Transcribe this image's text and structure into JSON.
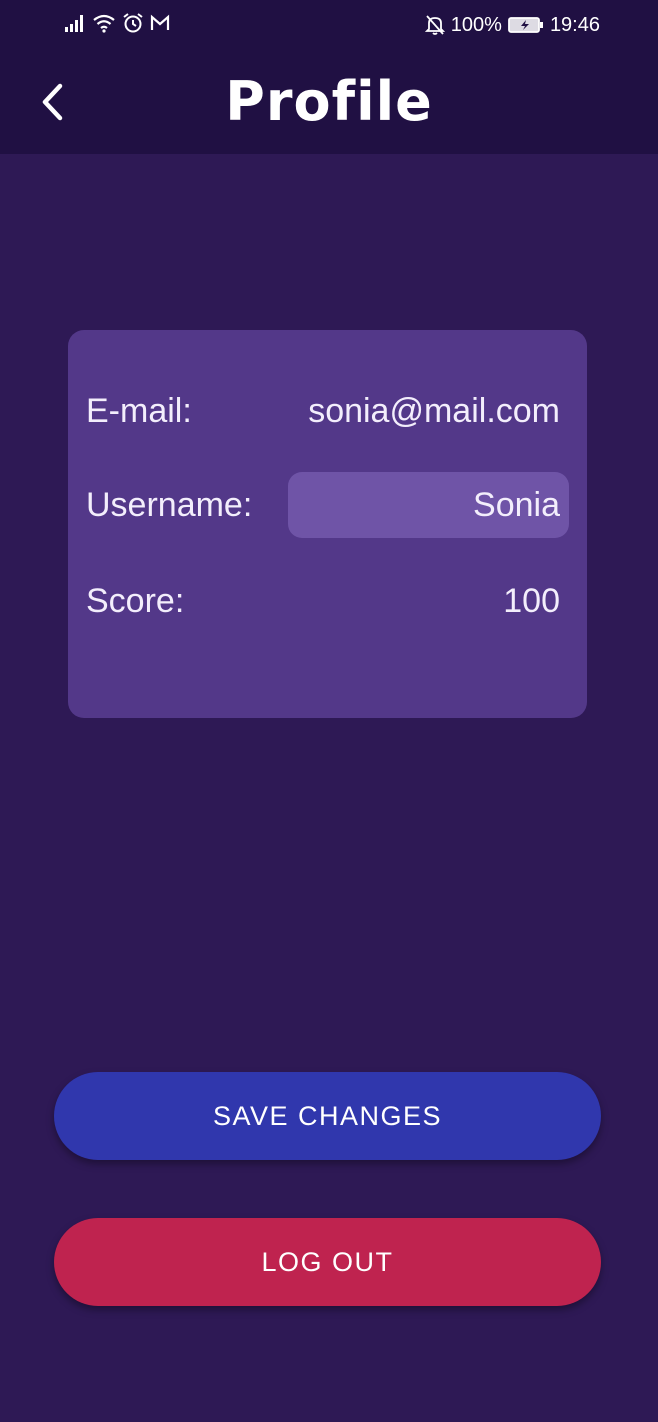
{
  "status_bar": {
    "battery": "100%",
    "time": "19:46",
    "icons_left": [
      "signal-icon",
      "wifi-icon",
      "alarm-icon",
      "gmail-icon"
    ],
    "icons_right": [
      "bell-off-icon",
      "battery-charging-icon"
    ]
  },
  "app_bar": {
    "title": "Profile",
    "back_icon": "chevron-left-icon"
  },
  "profile": {
    "email_label": "E-mail:",
    "email_value": "sonia@mail.com",
    "username_label": "Username:",
    "username_value": "Sonia",
    "score_label": "Score:",
    "score_value": "100"
  },
  "actions": {
    "save_label": "SAVE CHANGES",
    "logout_label": "LOG OUT"
  },
  "colors": {
    "background": "#2e1955",
    "header": "#201043",
    "card": "#533889",
    "input": "#6f54a7",
    "save_button": "#3037ad",
    "logout_button": "#bf234f"
  }
}
